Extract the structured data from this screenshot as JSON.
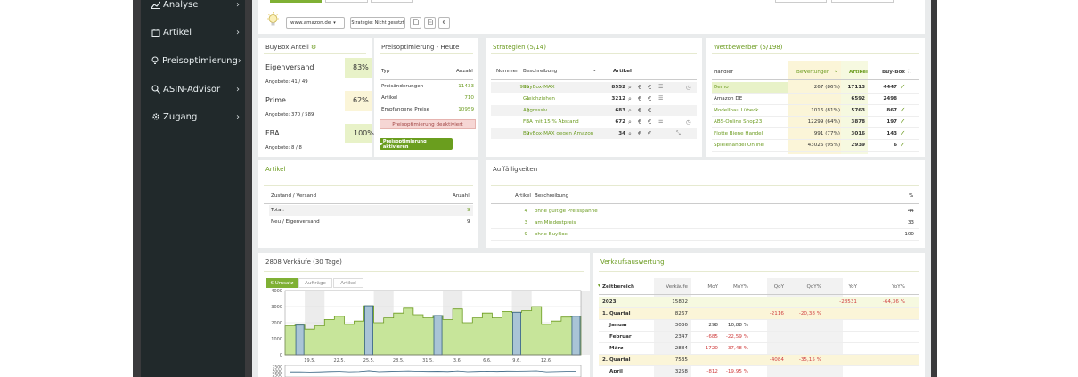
{
  "sidebar": {
    "items": [
      {
        "label": "Analyse",
        "icon": "chart-icon"
      },
      {
        "label": "Artikel",
        "icon": "bag-icon"
      },
      {
        "label": "Preisoptimierung",
        "icon": "bulb-icon"
      },
      {
        "label": "ASIN-Advisor",
        "icon": "search-icon"
      },
      {
        "label": "Zugang",
        "icon": "gear-icon"
      }
    ]
  },
  "toolbar": {
    "marketplace": "www.amazon.de",
    "strategy": "Strategie: Nicht gesetzt",
    "currency": "€"
  },
  "buybox": {
    "title": "BuyBox Anteil",
    "rows": [
      {
        "label": "Eigenversand",
        "pct": "83%",
        "offers": "Angebote: 41 / 49"
      },
      {
        "label": "Prime",
        "pct": "62%",
        "offers": "Angebote: 370 / 589"
      },
      {
        "label": "FBA",
        "pct": "100%",
        "offers": "Angebote: 8 / 8"
      }
    ]
  },
  "preisopt": {
    "title": "Preisoptimierung - Heute",
    "col_typ": "Typ",
    "col_anzahl": "Anzahl",
    "rows": [
      {
        "label": "Preisänderungen",
        "value": "11433"
      },
      {
        "label": "Artikel",
        "value": "710"
      },
      {
        "label": "Empfangene Preise",
        "value": "10959"
      }
    ],
    "status": "Preisoptimierung deaktiviert",
    "activate": "Preisoptimierung aktivieren"
  },
  "strategien": {
    "title": "Strategien (5/14)",
    "col_num": "Nummer",
    "col_desc": "Beschreibung",
    "col_art": "Artikel",
    "rows": [
      {
        "num": "999",
        "desc": "BuyBox-MAX",
        "art": "8552"
      },
      {
        "num": "1",
        "desc": "Gleichziehen",
        "art": "3212"
      },
      {
        "num": "2",
        "desc": "Aggressiv",
        "art": "683"
      },
      {
        "num": "5",
        "desc": "FBA mit 15 % Abstand",
        "art": "672"
      },
      {
        "num": "9",
        "desc": "BuyBox-MAX gegen Amazon",
        "art": "34"
      }
    ]
  },
  "wettbewerber": {
    "title": "Wettbewerber (5/198)",
    "col_h": "Händler",
    "col_bew": "Bewertungen",
    "col_art": "Artikel",
    "col_bb": "Buy-Box",
    "rows": [
      {
        "name": "Demo",
        "bew": "267 (86%)",
        "art": "17113",
        "bb": "4447",
        "check": true
      },
      {
        "name": "Amazon DE",
        "bew": "",
        "art": "6592",
        "bb": "2498",
        "check": false
      },
      {
        "name": "Modellbau Lübeck",
        "bew": "1016 (81%)",
        "art": "5763",
        "bb": "867",
        "check": true
      },
      {
        "name": "ABS-Online Shop23",
        "bew": "12299 (64%)",
        "art": "3878",
        "bb": "197",
        "check": true
      },
      {
        "name": "Flotte Biene Handel",
        "bew": "991 (77%)",
        "art": "3016",
        "bb": "143",
        "check": true
      },
      {
        "name": "Spielehandel Online",
        "bew": "43026 (95%)",
        "art": "2939",
        "bb": "6",
        "check": true
      }
    ]
  },
  "artikel": {
    "title": "Artikel",
    "col_z": "Zustand / Versand",
    "col_a": "Anzahl",
    "rows": [
      {
        "label": "Total:",
        "value": "9"
      },
      {
        "label": "Neu / Eigenversand",
        "value": "9"
      }
    ]
  },
  "auff": {
    "title": "Auffälligkeiten",
    "col_a": "Artikel",
    "col_b": "Beschreibung",
    "col_p": "%",
    "rows": [
      {
        "art": "4",
        "desc": "ohne gültige Preisspanne",
        "pct": "44"
      },
      {
        "art": "3",
        "desc": "am Mindestpreis",
        "pct": "33"
      },
      {
        "art": "9",
        "desc": "ohne BuyBox",
        "pct": "100"
      }
    ]
  },
  "verkaeufe": {
    "title": "2808 Verkäufe (30 Tage)",
    "tabs": [
      "€ Umsatz",
      "Aufträge",
      "Artikel"
    ]
  },
  "chart_data": {
    "type": "bar",
    "categories": [
      "",
      "",
      "19.5.",
      "",
      "",
      "22.5.",
      "",
      "",
      "25.5.",
      "",
      "",
      "28.5.",
      "",
      "",
      "31.5.",
      "",
      "",
      "3.6.",
      "",
      "",
      "6.6.",
      "",
      "",
      "9.6.",
      "",
      "",
      "12.6.",
      "",
      "",
      ""
    ],
    "values": [
      1800,
      1850,
      1600,
      1800,
      2200,
      2400,
      1900,
      2100,
      3050,
      2000,
      2300,
      2600,
      2900,
      2500,
      2300,
      2450,
      2200,
      2850,
      2000,
      2300,
      2600,
      2300,
      2700,
      2650,
      2750,
      3000,
      1900,
      2100,
      2350,
      2400
    ],
    "highlight": [
      false,
      true,
      false,
      false,
      false,
      false,
      false,
      false,
      true,
      false,
      false,
      false,
      false,
      false,
      false,
      true,
      false,
      false,
      false,
      false,
      false,
      false,
      false,
      true,
      false,
      false,
      false,
      false,
      false,
      true
    ],
    "yticks": [
      "0",
      "1000",
      "2000",
      "3000",
      "4000"
    ],
    "ylim": [
      0,
      4000
    ],
    "lower_yticks": [
      "7500",
      "5000",
      "2500"
    ]
  },
  "auswertung": {
    "title": "Verkaufsauswertung",
    "cols": [
      "Zeitbereich",
      "Verkäufe",
      "MoY",
      "MoY%",
      "QoY",
      "QoY%",
      "YoY",
      "YoY%"
    ],
    "rows": [
      {
        "c": [
          "2023",
          "15802",
          "",
          "",
          "",
          "",
          "-28531",
          "-64,36 %"
        ],
        "lvl": 0
      },
      {
        "c": [
          "1. Quartal",
          "8267",
          "",
          "",
          "-2116",
          "-20,38 %",
          "",
          ""
        ],
        "lvl": 1
      },
      {
        "c": [
          "Januar",
          "3036",
          "298",
          "10,88 %",
          "",
          "",
          "",
          ""
        ],
        "lvl": 2
      },
      {
        "c": [
          "Februar",
          "2347",
          "-685",
          "-22,59 %",
          "",
          "",
          "",
          ""
        ],
        "lvl": 2
      },
      {
        "c": [
          "März",
          "2884",
          "-1720",
          "-37,48 %",
          "",
          "",
          "",
          ""
        ],
        "lvl": 2
      },
      {
        "c": [
          "2. Quartal",
          "7535",
          "",
          "",
          "-4084",
          "-35,15 %",
          "",
          ""
        ],
        "lvl": 1
      },
      {
        "c": [
          "April",
          "3258",
          "-812",
          "-19,95 %",
          "",
          "",
          "",
          ""
        ],
        "lvl": 2
      }
    ]
  }
}
